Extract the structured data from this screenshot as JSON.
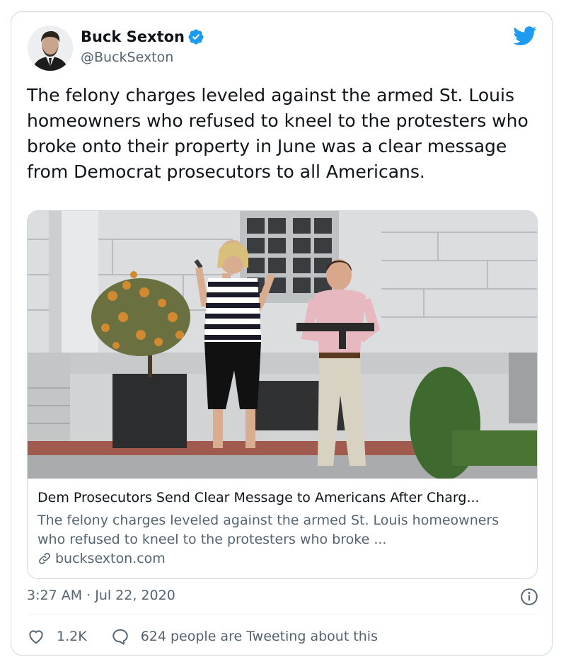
{
  "author": {
    "name": "Buck Sexton",
    "handle": "@BuckSexton",
    "verified": true
  },
  "tweet": {
    "text": "The felony charges leveled against the armed St. Louis homeowners who refused to kneel to the protesters who broke onto their property in June was a clear message from Democrat prosecutors to all Americans."
  },
  "link_card": {
    "title": "Dem Prosecutors Send Clear Message to Americans After Charg...",
    "description": "The felony charges leveled against the armed St. Louis homeowners who refused to kneel to the protesters who broke ...",
    "domain": "bucksexton.com"
  },
  "meta": {
    "timestamp": "3:27 AM · Jul 22, 2020"
  },
  "actions": {
    "likes": "1.2K",
    "conversation": "624 people are Tweeting about this"
  },
  "colors": {
    "accent": "#1d9bf0",
    "text_primary": "#0f1419",
    "text_secondary": "#536471",
    "border": "#cfd9de"
  },
  "icons": [
    "avatar",
    "verified-badge-icon",
    "twitter-bird-icon",
    "link-icon",
    "info-icon",
    "heart-icon",
    "speech-bubble-icon"
  ]
}
